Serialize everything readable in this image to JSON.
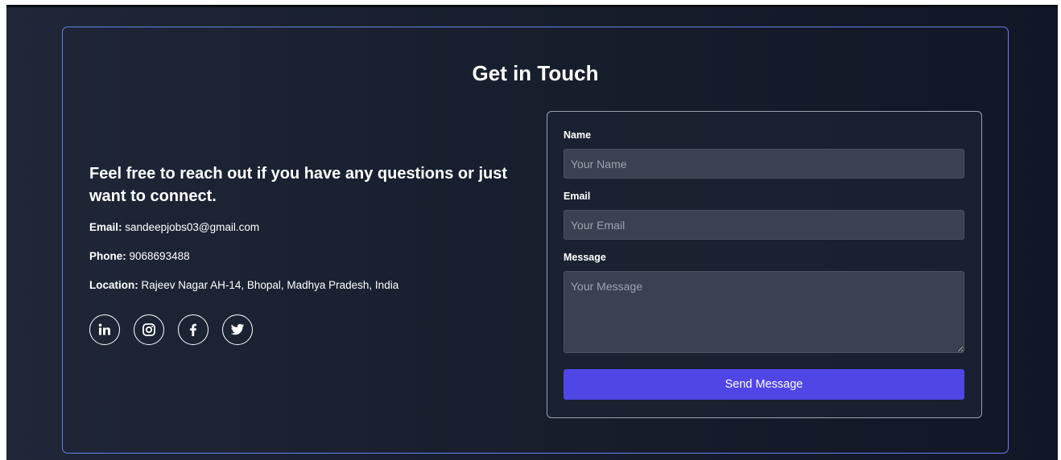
{
  "section": {
    "title": "Get in Touch"
  },
  "info": {
    "tagline": "Feel free to reach out if you have any questions or just want to connect.",
    "email_label": "Email:",
    "email_value": "sandeepjobs03@gmail.com",
    "phone_label": "Phone:",
    "phone_value": "9068693488",
    "location_label": "Location:",
    "location_value": "Rajeev Nagar AH-14, Bhopal, Madhya Pradesh, India"
  },
  "socials": [
    "linkedin-icon",
    "instagram-icon",
    "facebook-icon",
    "twitter-icon"
  ],
  "form": {
    "name_label": "Name",
    "name_placeholder": "Your Name",
    "name_value": "",
    "email_label": "Email",
    "email_placeholder": "Your Email",
    "email_value": "",
    "message_label": "Message",
    "message_placeholder": "Your Message",
    "message_value": "",
    "submit_label": "Send Message"
  },
  "colors": {
    "accent": "#4f46e5",
    "card_border": "#6d7ee8",
    "background": "#161d2b",
    "field_bg": "#3b4150"
  }
}
